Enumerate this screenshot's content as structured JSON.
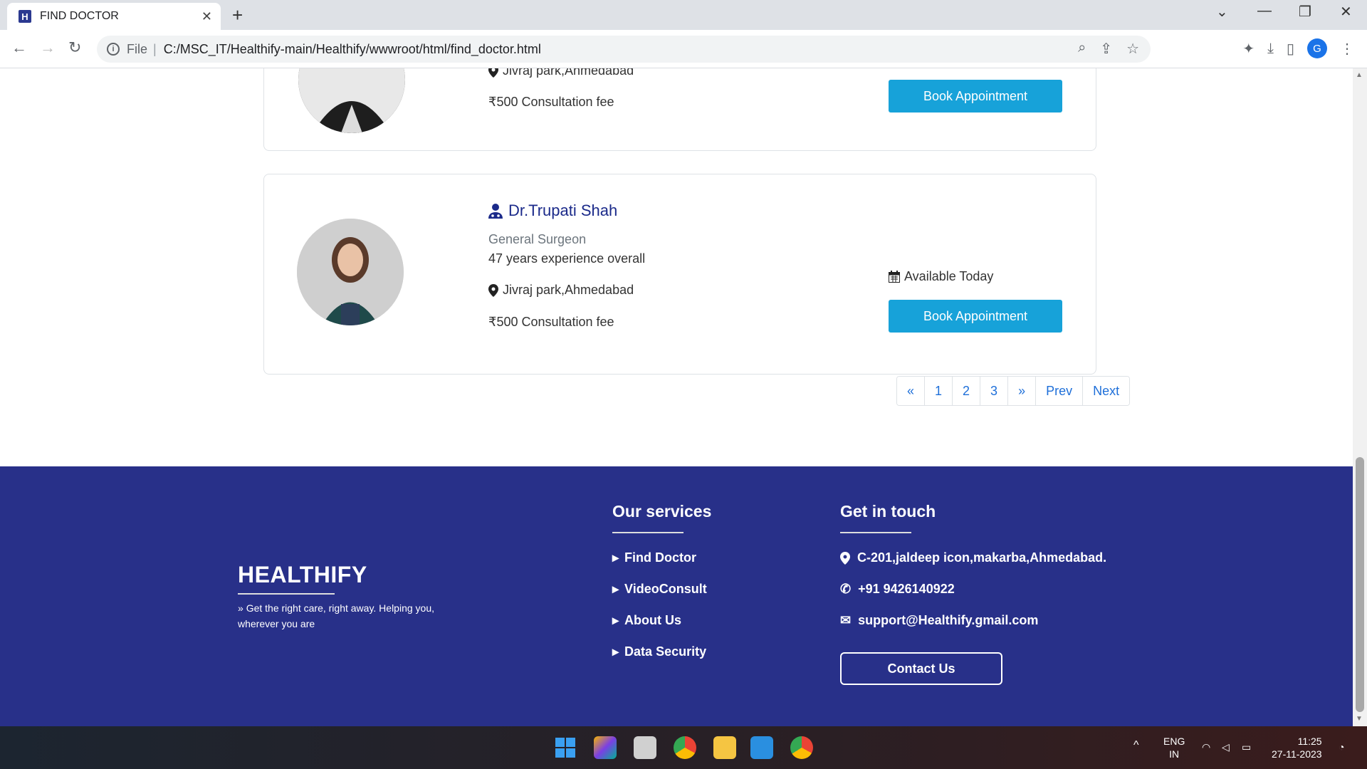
{
  "browser": {
    "tab_title": "FIND DOCTOR",
    "favicon_letter": "H",
    "omnibox_scheme": "File",
    "url": "C:/MSC_IT/Healthify-main/Healthify/wwwroot/html/find_doctor.html",
    "profile_letter": "G"
  },
  "doctors": [
    {
      "location": "Jivraj park,Ahmedabad",
      "fee": "₹500 Consultation fee",
      "book_label": "Book Appointment"
    },
    {
      "name": "Dr.Trupati Shah",
      "specialty": "General Surgeon",
      "experience": "47 years experience overall",
      "location": "Jivraj park,Ahmedabad",
      "fee": "₹500 Consultation fee",
      "availability": "Available Today",
      "book_label": "Book Appointment"
    }
  ],
  "pagination": [
    "«",
    "1",
    "2",
    "3",
    "»",
    "Prev",
    "Next"
  ],
  "footer": {
    "brand": "HEALTHIFY",
    "tagline": "Get the right care, right away. Helping you, wherever you are",
    "services_title": "Our services",
    "services": [
      "Find Doctor",
      "VideoConsult",
      "About Us",
      "Data Security"
    ],
    "contact_title": "Get in touch",
    "address": "C-201,jaldeep icon,makarba,Ahmedabad.",
    "phone": "+91 9426140922",
    "email": "support@Healthify.gmail.com",
    "contact_button": "Contact Us"
  },
  "taskbar": {
    "lang": "ENG",
    "region": "IN",
    "time": "11:25",
    "date": "27-11-2023"
  },
  "colors": {
    "footer_bg": "#283089",
    "button_bg": "#17a2d9",
    "doctor_name": "#1b2a8a",
    "link": "#1e6fd9"
  }
}
